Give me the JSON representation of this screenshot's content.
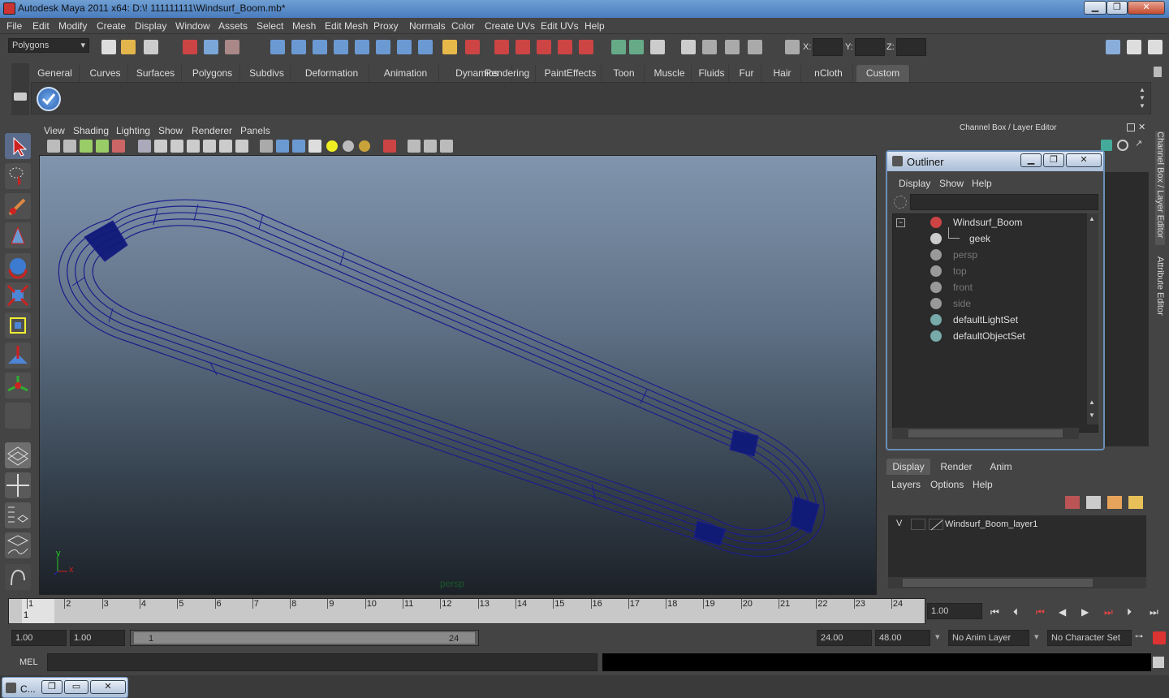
{
  "window": {
    "title": "Autodesk Maya 2011 x64: D:\\! 111111111\\Windsurf_Boom.mb*",
    "min": "▁",
    "max": "❐",
    "close": "✕"
  },
  "menu": [
    "File",
    "Edit",
    "Modify",
    "Create",
    "Display",
    "Window",
    "Assets",
    "Select",
    "Mesh",
    "Edit Mesh",
    "Proxy",
    "Normals",
    "Color",
    "Create UVs",
    "Edit UVs",
    "Help"
  ],
  "mode_selector": {
    "value": "Polygons"
  },
  "coords": {
    "x_label": "X:",
    "y_label": "Y:",
    "z_label": "Z:"
  },
  "shelf_tabs": [
    "General",
    "Curves",
    "Surfaces",
    "Polygons",
    "Subdivs",
    "Deformation",
    "Animation",
    "Dynamics",
    "Rendering",
    "PaintEffects",
    "Toon",
    "Muscle",
    "Fluids",
    "Fur",
    "Hair",
    "nCloth",
    "Custom"
  ],
  "shelf_active": "Custom",
  "panel_menu": [
    "View",
    "Shading",
    "Lighting",
    "Show",
    "Renderer",
    "Panels"
  ],
  "viewport": {
    "camera_label": "persp",
    "axis_x": "x",
    "axis_y": "y"
  },
  "channel_box": {
    "title": "Channel Box / Layer Editor"
  },
  "outliner": {
    "title": "Outliner",
    "menu": [
      "Display",
      "Show",
      "Help"
    ],
    "items": [
      {
        "label": "Windsurf_Boom",
        "dim": false,
        "icon": "mesh-group-icon"
      },
      {
        "label": "geek",
        "dim": false,
        "icon": "mesh-icon"
      },
      {
        "label": "persp",
        "dim": true,
        "icon": "camera-icon"
      },
      {
        "label": "top",
        "dim": true,
        "icon": "camera-icon"
      },
      {
        "label": "front",
        "dim": true,
        "icon": "camera-icon"
      },
      {
        "label": "side",
        "dim": true,
        "icon": "camera-icon"
      },
      {
        "label": "defaultLightSet",
        "dim": false,
        "icon": "set-icon"
      },
      {
        "label": "defaultObjectSet",
        "dim": false,
        "icon": "set-icon"
      }
    ]
  },
  "side_tabs": {
    "channel_box": "Channel Box / Layer Editor",
    "attribute_editor": "Attribute Editor"
  },
  "layer_editor": {
    "tabs": [
      "Display",
      "Render",
      "Anim"
    ],
    "menu": [
      "Layers",
      "Options",
      "Help"
    ],
    "layer_visibility": "V",
    "layer_name": "Windsurf_Boom_layer1"
  },
  "timeline": {
    "ticks": [
      "1",
      "2",
      "3",
      "4",
      "5",
      "6",
      "7",
      "8",
      "9",
      "10",
      "11",
      "12",
      "13",
      "14",
      "15",
      "16",
      "17",
      "18",
      "19",
      "20",
      "21",
      "22",
      "23",
      "24"
    ],
    "current_frame_marker": "1",
    "current_time": "1.00"
  },
  "range": {
    "start_time": "1.00",
    "playback_start": "1.00",
    "range_start_label": "1",
    "range_end_label": "24",
    "playback_end": "24.00",
    "end_time": "48.00",
    "anim_layer": "No Anim Layer",
    "character_set": "No Character Set"
  },
  "command_line": {
    "label": "MEL"
  },
  "taskbar": {
    "item": "C..."
  }
}
